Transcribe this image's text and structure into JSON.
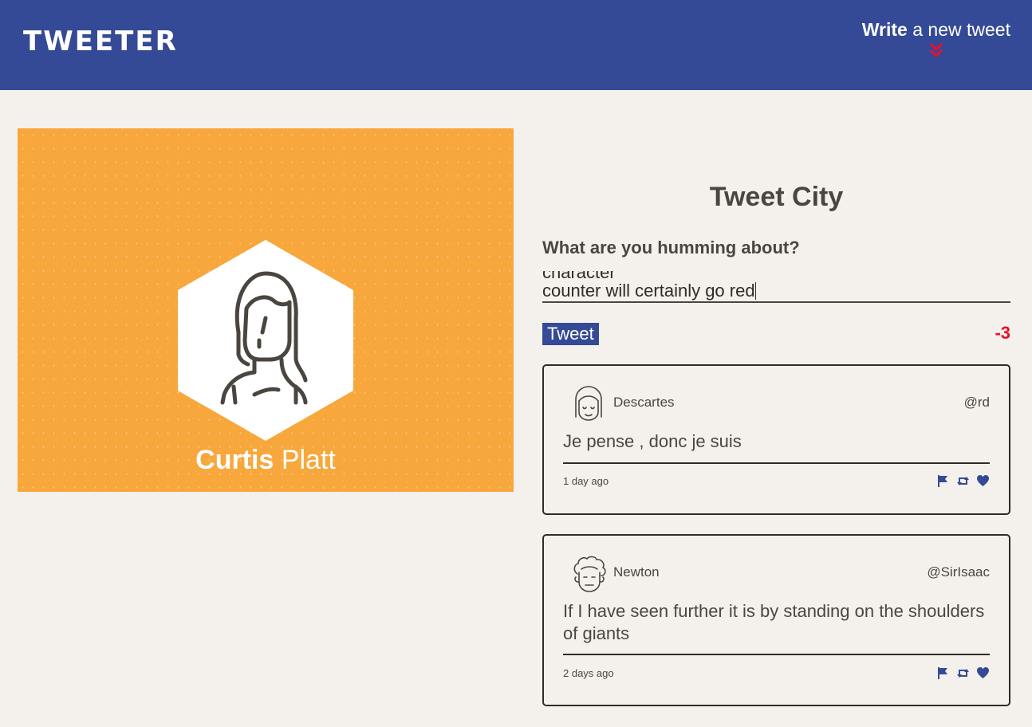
{
  "header": {
    "logo": "TWEETER",
    "compose_bold": "Write",
    "compose_rest": " a new tweet",
    "colors": {
      "bar": "#354a96",
      "accent": "#e8102a"
    }
  },
  "profile": {
    "first_name": "Curtis",
    "last_name": " Platt",
    "card_color": "#f7a73b",
    "avatar_icon": "woman-avatar-icon"
  },
  "compose_form": {
    "title": "Tweet City",
    "prompt": "What are you humming about?",
    "text_line1": "message and I believe if I write enough then the character",
    "text_line2": "counter will certainly go red",
    "submit_label": "Tweet",
    "counter": "-3"
  },
  "tweets": [
    {
      "name": "Descartes",
      "handle": "@rd",
      "content": "Je pense , donc je suis",
      "age": "1 day ago",
      "avatar_icon": "descartes-avatar-icon"
    },
    {
      "name": "Newton",
      "handle": "@SirIsaac",
      "content": "If I have seen further it is by standing on the shoulders of giants",
      "age": "2 days ago",
      "avatar_icon": "newton-avatar-icon"
    }
  ],
  "action_icons": [
    "flag-icon",
    "retweet-icon",
    "heart-icon"
  ]
}
